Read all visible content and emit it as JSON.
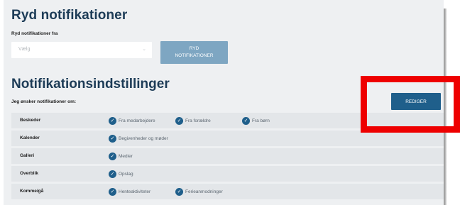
{
  "clear_section": {
    "title": "Ryd notifikationer",
    "field_label": "Ryd notifikationer fra",
    "select_placeholder": "Vælg",
    "button_line1": "RYD",
    "button_line2": "NOTIFIKATIONER"
  },
  "settings_section": {
    "title": "Notifikationsindstillinger",
    "subtitle": "Jeg ønsker notifikationer om:",
    "edit_button": "REDIGER"
  },
  "rows": [
    {
      "label": "Beskeder",
      "options": [
        "Fra medarbejdere",
        "Fra forældre",
        "Fra børn"
      ]
    },
    {
      "label": "Kalender",
      "options": [
        "Begivenheder og møder"
      ]
    },
    {
      "label": "Galleri",
      "options": [
        "Medier"
      ]
    },
    {
      "label": "Overblik",
      "options": [
        "Opslag"
      ]
    },
    {
      "label": "Komme/gå",
      "options": [
        "Henteaktiviteter",
        "Ferieanmodninger"
      ]
    }
  ],
  "icons": {
    "select_chevron": "chevron-down-icon",
    "option_check": "check-circle-icon"
  },
  "colors": {
    "primary": "#1f5f8b",
    "primary_disabled": "#7ea6c2",
    "heading": "#1d3c57",
    "highlight": "#ee0000"
  }
}
